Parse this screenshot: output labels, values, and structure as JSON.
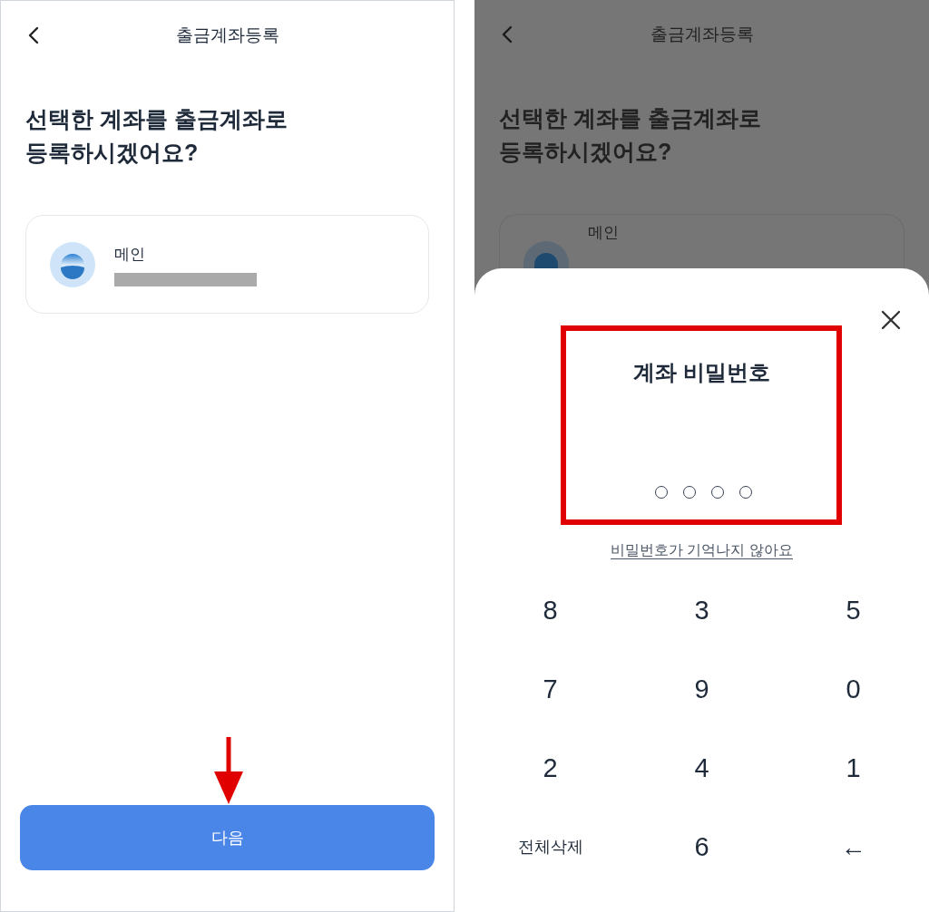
{
  "left_screen": {
    "header": {
      "title": "출금계좌등록"
    },
    "heading": [
      "선택한 계좌를 출금계좌로",
      "등록하시겠어요?"
    ],
    "account": {
      "name": "메인"
    },
    "next_button": "다음"
  },
  "right_screen": {
    "dimmed": true,
    "header": {
      "title": "출금계좌등록"
    },
    "heading": [
      "선택한 계좌를 출금계좌로",
      "등록하시겠어요?"
    ],
    "account": {
      "name": "메인"
    },
    "pin_sheet": {
      "title": "계좌 비밀번호",
      "pin_dots": [
        {
          "filled": false
        },
        {
          "filled": false
        },
        {
          "filled": false
        },
        {
          "filled": false
        }
      ],
      "forgot_link": "비밀번호가 기억나지 않아요",
      "keypad": [
        {
          "label": "8",
          "kind": "digit"
        },
        {
          "label": "3",
          "kind": "digit"
        },
        {
          "label": "5",
          "kind": "digit"
        },
        {
          "label": "7",
          "kind": "digit"
        },
        {
          "label": "9",
          "kind": "digit"
        },
        {
          "label": "0",
          "kind": "digit"
        },
        {
          "label": "2",
          "kind": "digit"
        },
        {
          "label": "4",
          "kind": "digit"
        },
        {
          "label": "1",
          "kind": "digit"
        },
        {
          "label": "전체삭제",
          "kind": "clear"
        },
        {
          "label": "6",
          "kind": "digit"
        },
        {
          "label": "←",
          "kind": "backspace"
        }
      ]
    }
  }
}
